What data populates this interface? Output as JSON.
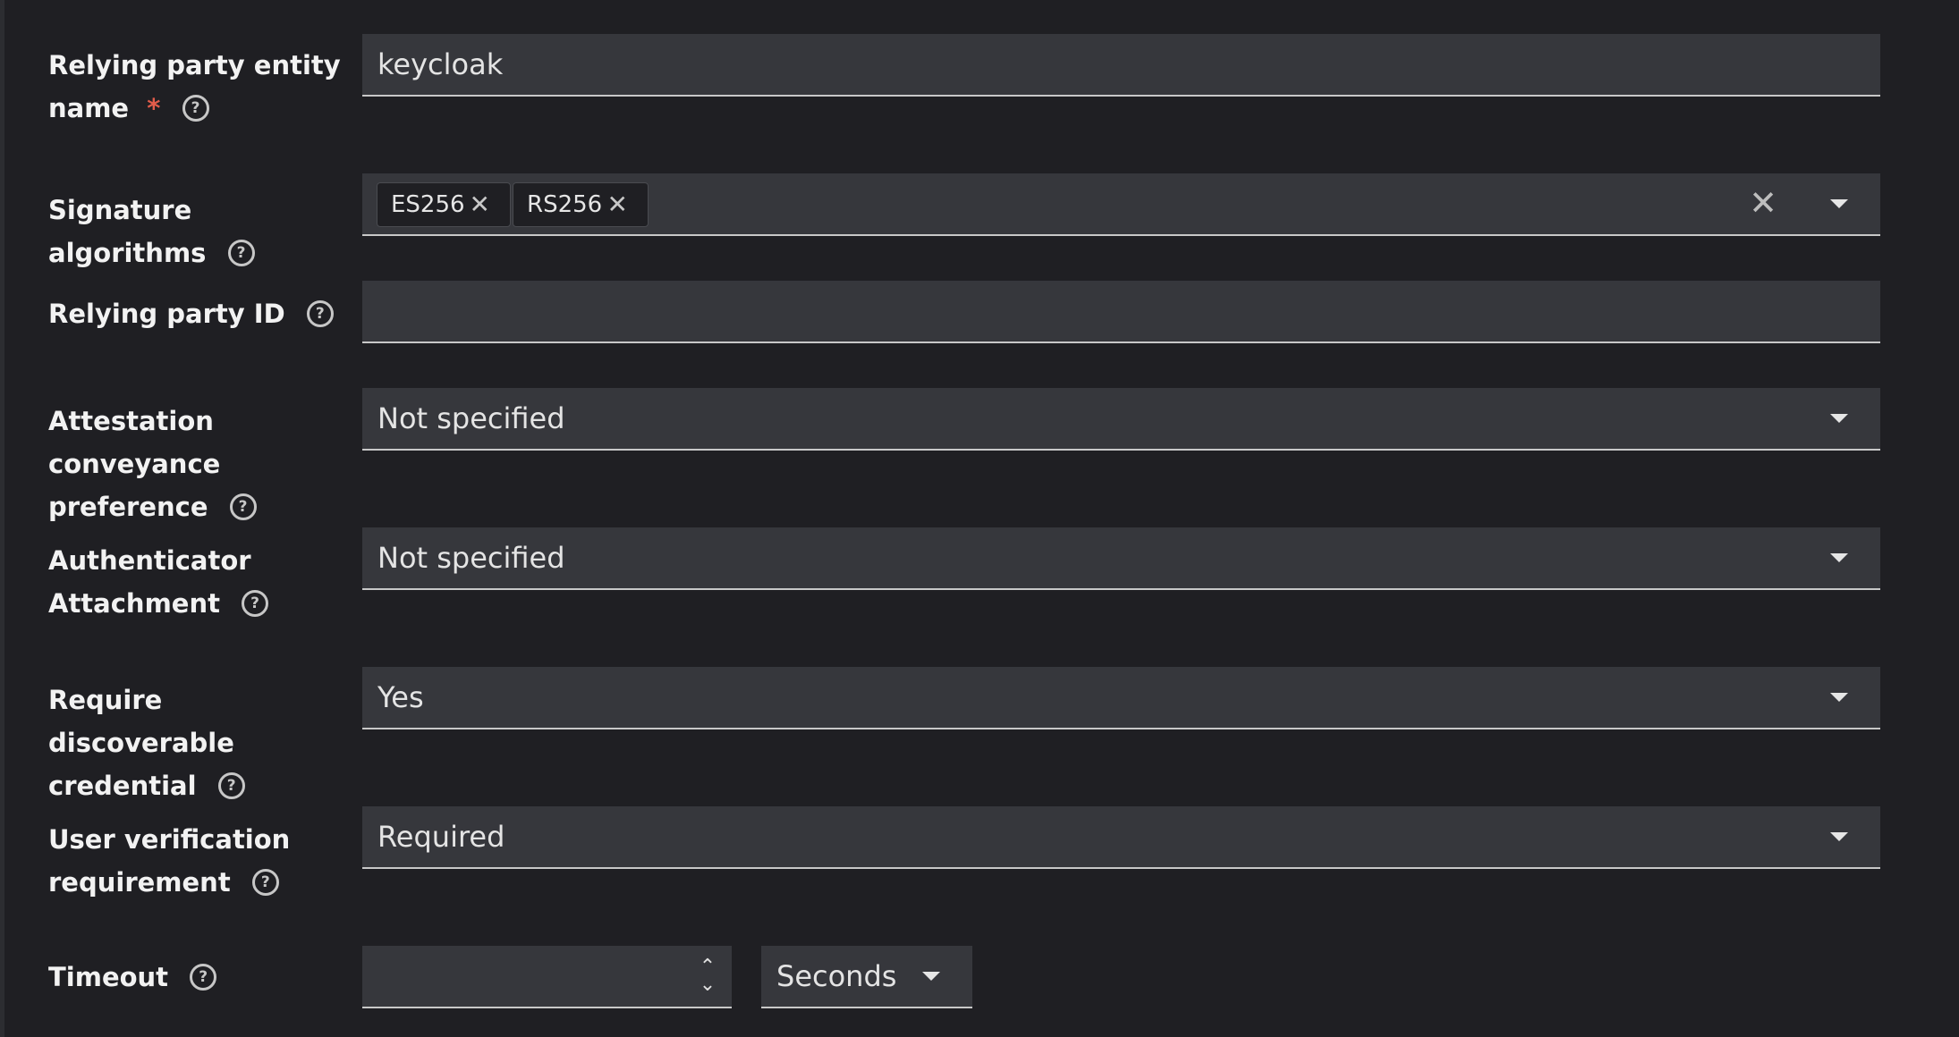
{
  "form": {
    "rp_entity_name": {
      "label_line1": "Relying party entity",
      "label_line2": "name",
      "required_mark": "*",
      "value": "keycloak"
    },
    "signature_algorithms": {
      "label": "Signature algorithms",
      "chips": [
        "ES256",
        "RS256"
      ]
    },
    "rp_id": {
      "label": "Relying party ID",
      "value": ""
    },
    "attestation": {
      "label_line1": "Attestation conveyance",
      "label_line2": "preference",
      "value": "Not specified"
    },
    "authenticator_attachment": {
      "label_line1": "Authenticator",
      "label_line2": "Attachment",
      "value": "Not specified"
    },
    "require_discoverable": {
      "label_line1": "Require discoverable",
      "label_line2": "credential",
      "value": "Yes"
    },
    "user_verification": {
      "label_line1": "User verification",
      "label_line2": "requirement",
      "value": "Required"
    },
    "timeout": {
      "label": "Timeout",
      "value": "",
      "unit": "Seconds"
    }
  },
  "icons": {
    "help": "help-circle-icon",
    "remove_chip": "times-icon",
    "clear_all": "times-icon",
    "dropdown": "caret-down-icon",
    "spinner": "up-down-icon"
  },
  "colors": {
    "background": "#1f1f23",
    "control": "#36373c",
    "required": "#e25c4a",
    "text": "#f2f2f2"
  }
}
